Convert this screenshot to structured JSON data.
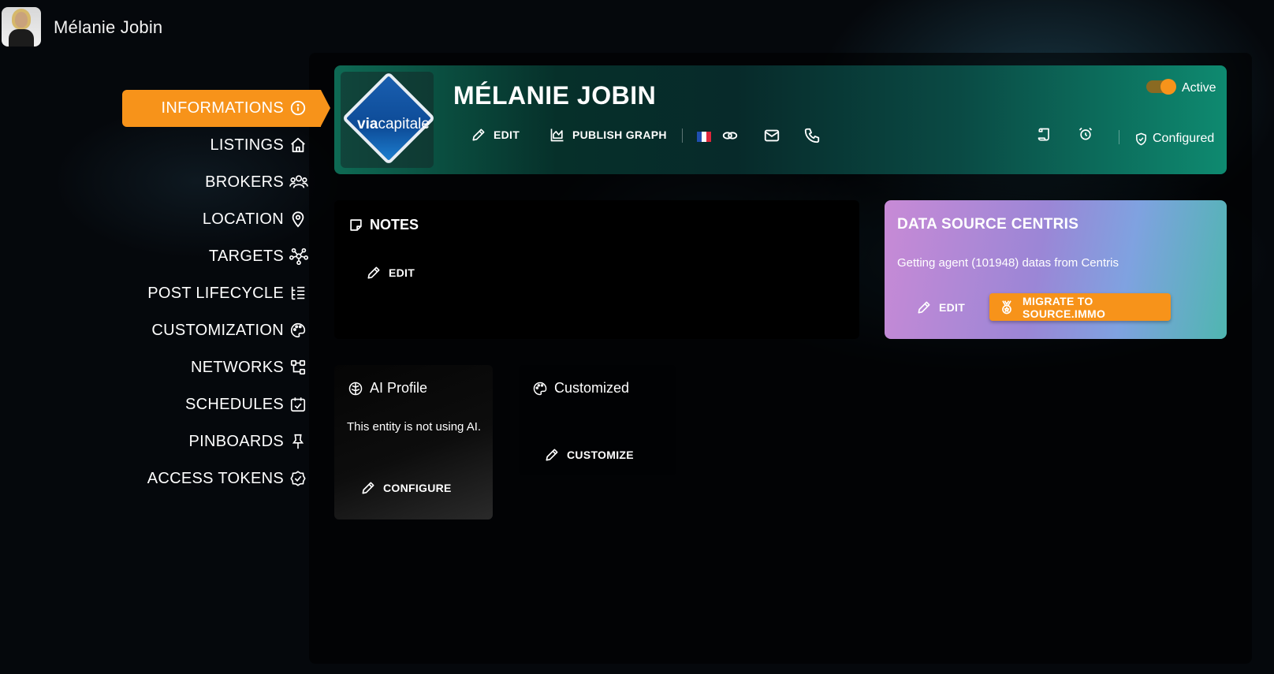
{
  "user": {
    "name": "Mélanie Jobin"
  },
  "sidebar": {
    "items": [
      {
        "label": "INFORMATIONS",
        "icon": "info-icon",
        "active": true
      },
      {
        "label": "LISTINGS",
        "icon": "home-icon"
      },
      {
        "label": "BROKERS",
        "icon": "users-icon"
      },
      {
        "label": "LOCATION",
        "icon": "map-pin-icon"
      },
      {
        "label": "TARGETS",
        "icon": "network-icon"
      },
      {
        "label": "POST LIFECYCLE",
        "icon": "list-tree-icon"
      },
      {
        "label": "CUSTOMIZATION",
        "icon": "palette-icon"
      },
      {
        "label": "NETWORKS",
        "icon": "sitemap-icon"
      },
      {
        "label": "SCHEDULES",
        "icon": "calendar-check-icon"
      },
      {
        "label": "PINBOARDS",
        "icon": "pin-icon"
      },
      {
        "label": "ACCESS TOKENS",
        "icon": "badge-check-icon"
      }
    ]
  },
  "header": {
    "logo_text_bold": "via",
    "logo_text_rest": "capitale",
    "name": "MÉLANIE JOBIN",
    "edit_label": "EDIT",
    "publish_graph_label": "PUBLISH GRAPH",
    "status_label": "Active",
    "configured_label": "Configured"
  },
  "notes": {
    "title": "NOTES",
    "edit_label": "EDIT"
  },
  "data_source": {
    "title": "DATA SOURCE CENTRIS",
    "description": "Getting agent (101948) datas from Centris",
    "edit_label": "EDIT",
    "migrate_label": "MIGRATE TO SOURCE.IMMO"
  },
  "ai_profile": {
    "title": "AI Profile",
    "description": "This entity is not using AI.",
    "configure_label": "CONFIGURE"
  },
  "customized": {
    "title": "Customized",
    "customize_label": "CUSTOMIZE"
  },
  "colors": {
    "accent": "#f7931a",
    "header_teal": "#0e8a70"
  }
}
